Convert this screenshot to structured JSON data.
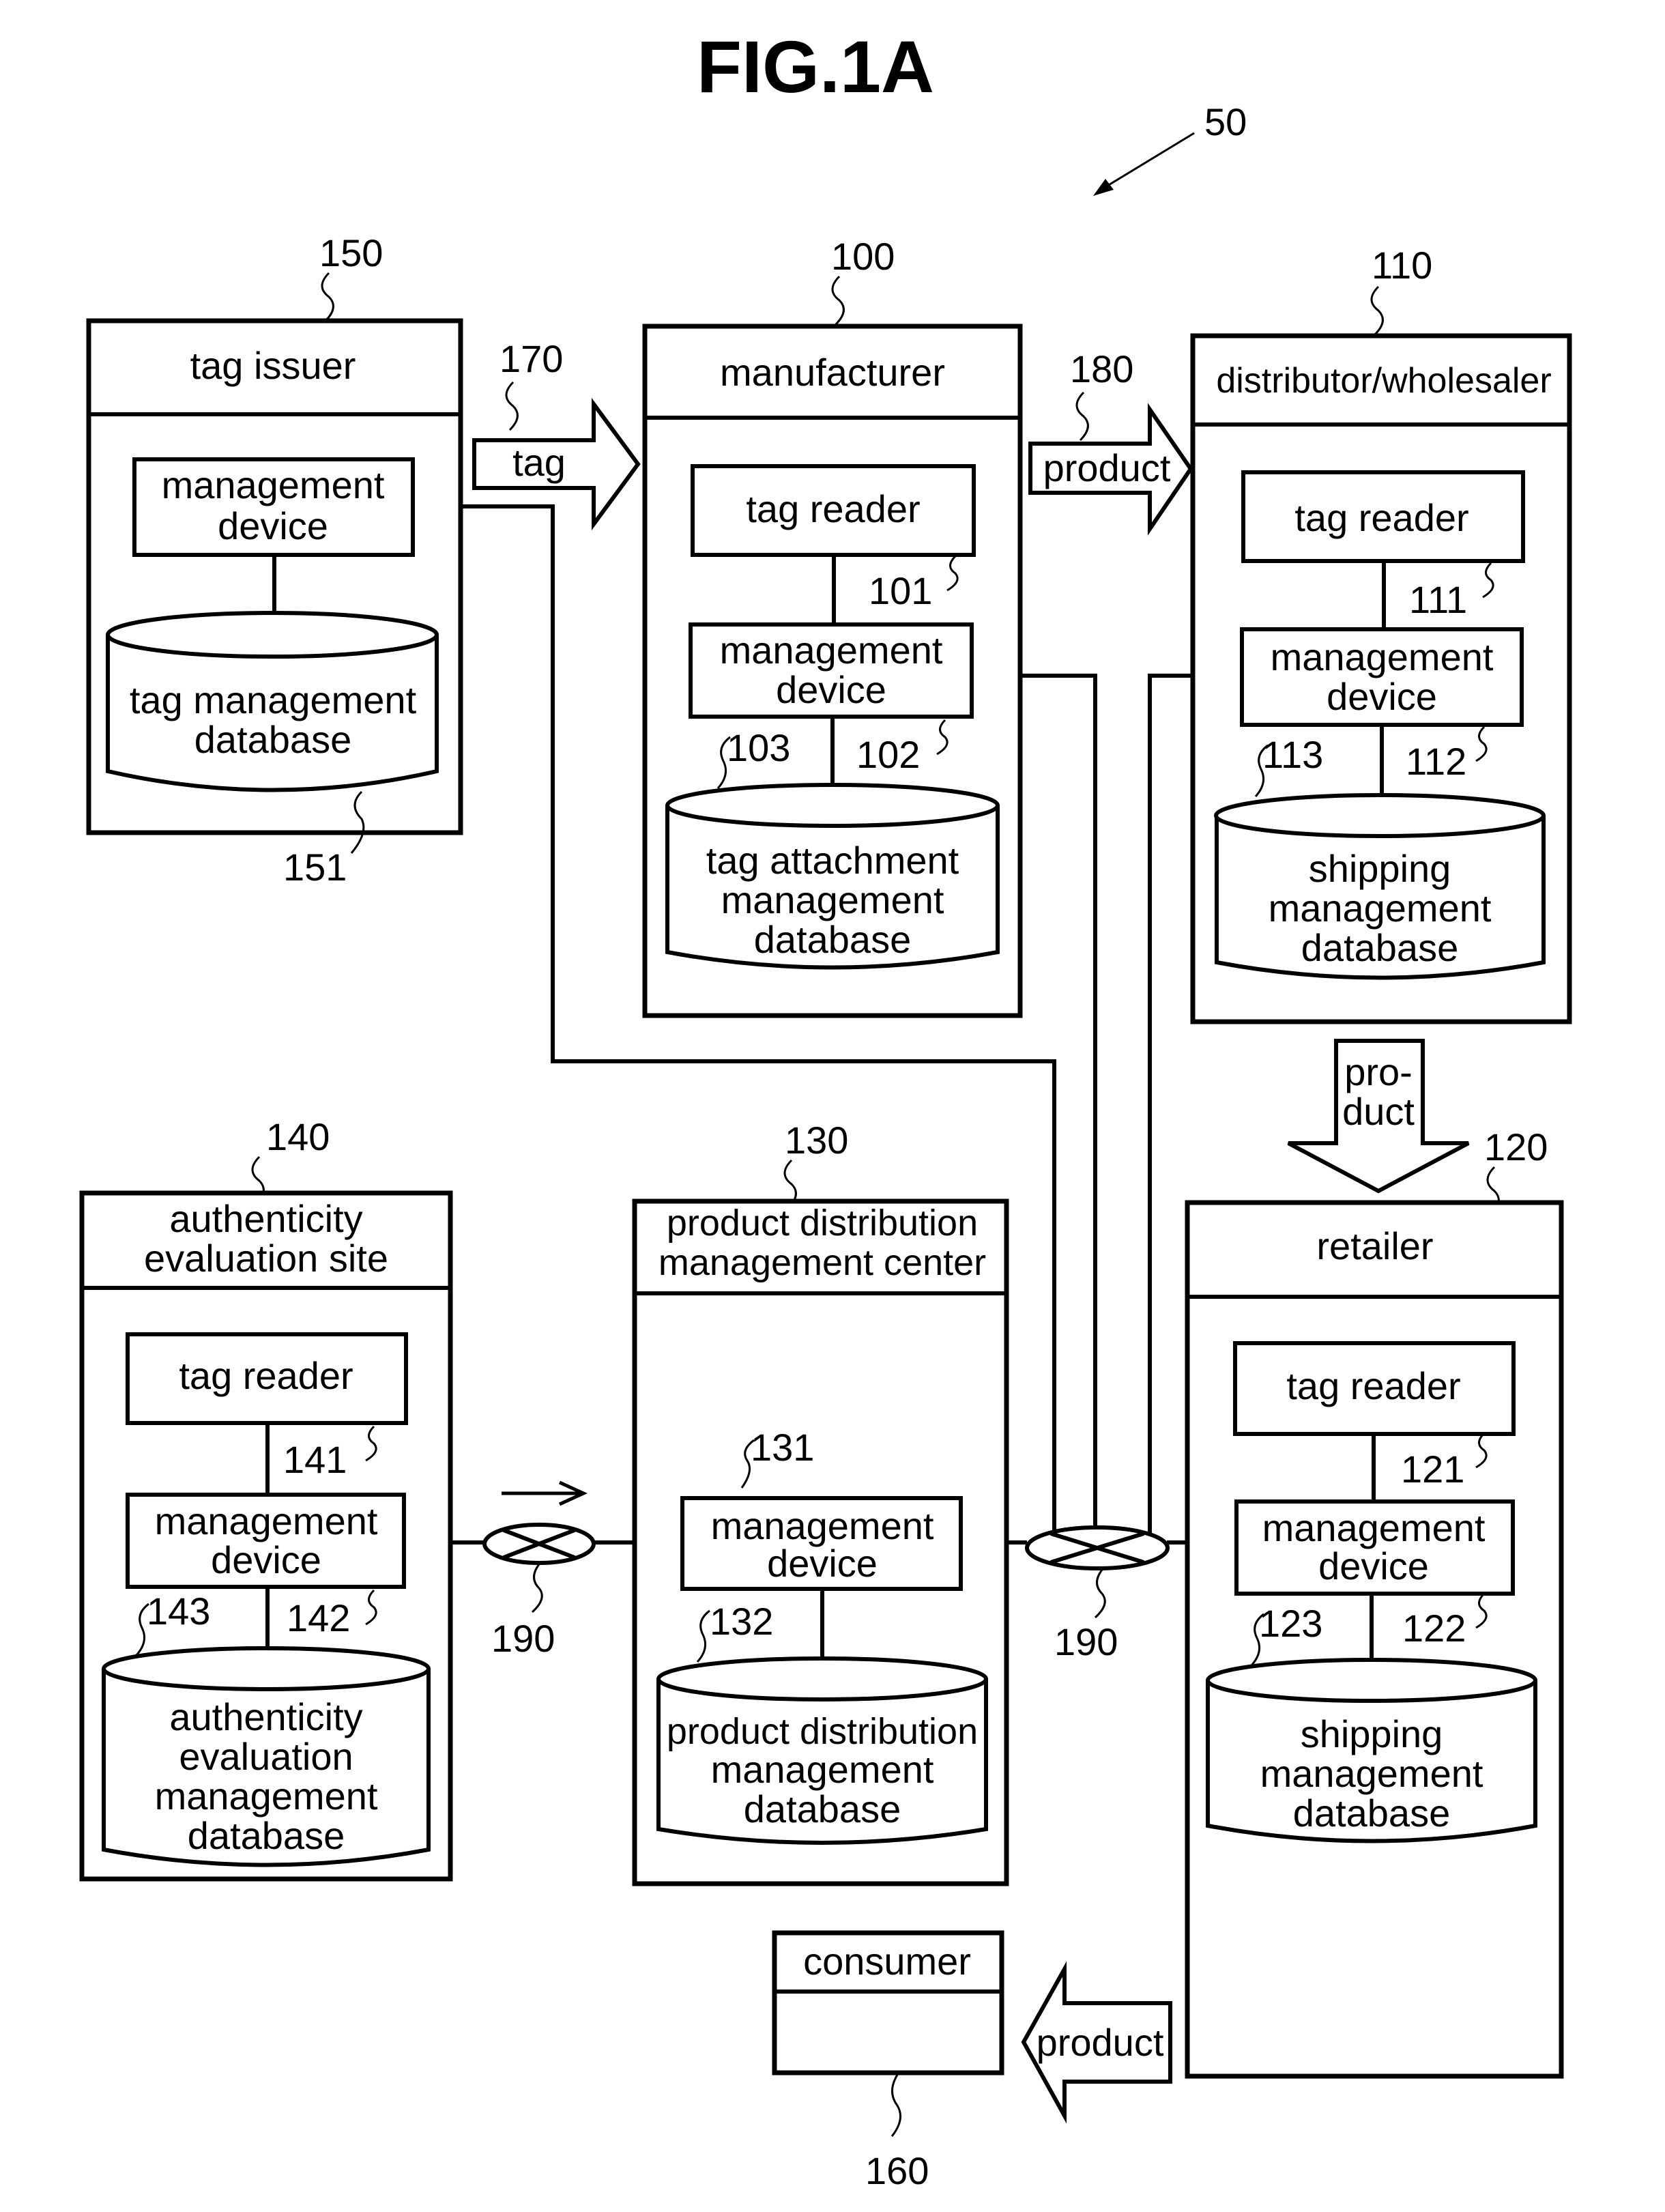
{
  "figure_title": "FIG.1A",
  "system_ref": "50",
  "entities": {
    "tag_issuer": {
      "ref": "150",
      "title": "tag issuer",
      "device": [
        "management",
        "device"
      ],
      "database": [
        "tag management",
        "database"
      ],
      "database_ref": "151"
    },
    "manufacturer": {
      "ref": "100",
      "title": "manufacturer",
      "reader": "tag reader",
      "reader_ref": "101",
      "device": [
        "management",
        "device"
      ],
      "device_ref": "102",
      "database": [
        "tag attachment",
        "management",
        "database"
      ],
      "database_ref": "103"
    },
    "distributor": {
      "ref": "110",
      "title": "distributor/wholesaler",
      "reader": "tag reader",
      "reader_ref": "111",
      "device": [
        "management",
        "device"
      ],
      "device_ref": "112",
      "database": [
        "shipping",
        "management",
        "database"
      ],
      "database_ref": "113"
    },
    "retailer": {
      "ref": "120",
      "title": "retailer",
      "reader": "tag reader",
      "reader_ref": "121",
      "device": [
        "management",
        "device"
      ],
      "device_ref": "122",
      "database": [
        "shipping",
        "management",
        "database"
      ],
      "database_ref": "123"
    },
    "center": {
      "ref": "130",
      "title": [
        "product distribution",
        "management center"
      ],
      "device": [
        "management",
        "device"
      ],
      "device_ref": "131",
      "database": [
        "product distribution",
        "management",
        "database"
      ],
      "database_ref": "132"
    },
    "evaluation_site": {
      "ref": "140",
      "title": [
        "authenticity",
        "evaluation site"
      ],
      "reader": "tag reader",
      "reader_ref": "141",
      "device": [
        "management",
        "device"
      ],
      "device_ref": "142",
      "database": [
        "authenticity",
        "evaluation",
        "management",
        "database"
      ],
      "database_ref": "143"
    },
    "consumer": {
      "ref": "160",
      "title": "consumer"
    }
  },
  "flows": {
    "tag": {
      "ref": "170",
      "label": "tag"
    },
    "product_to_distributor": {
      "ref": "180",
      "label": "product"
    },
    "product_to_retailer": {
      "label": [
        "pro-",
        "duct"
      ]
    },
    "product_to_consumer": {
      "label": "product"
    }
  },
  "network": {
    "left_ref": "190",
    "right_ref": "190"
  }
}
